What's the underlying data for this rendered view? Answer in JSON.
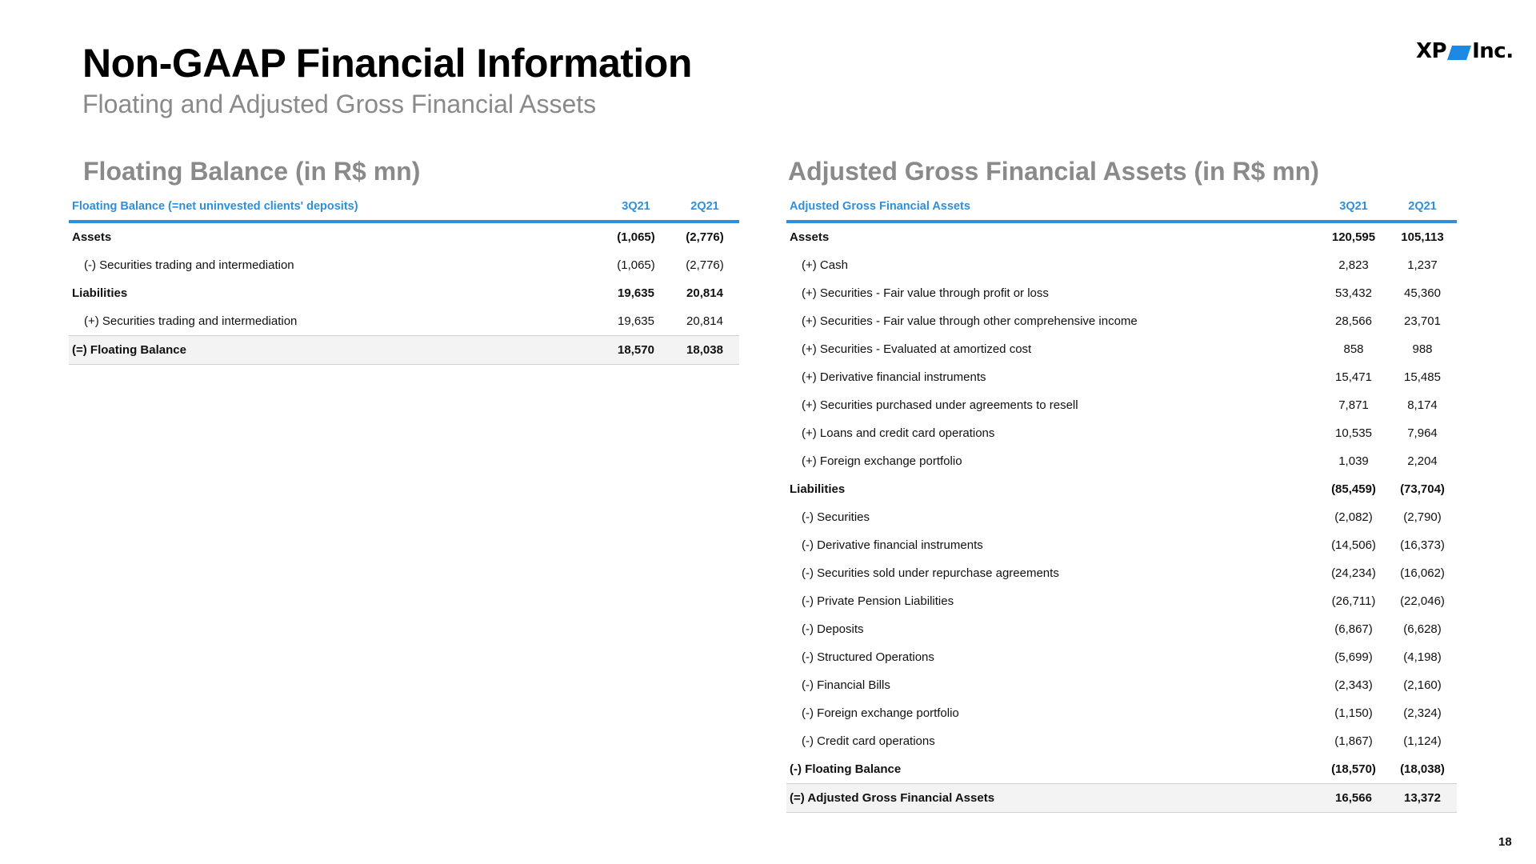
{
  "header": {
    "title": "Non-GAAP Financial Information",
    "subtitle": "Floating and Adjusted Gross Financial Assets",
    "logo_text_left": "XP",
    "logo_text_right": "Inc."
  },
  "colors": {
    "accent_blue": "#2f8fd8",
    "logo_blue": "#1e88e5",
    "section_gray": "#8a8a8a"
  },
  "floating": {
    "section_title": "Floating Balance (in R$ mn)",
    "columns": [
      "Floating Balance (=net uninvested clients' deposits)",
      "3Q21",
      "2Q21"
    ],
    "rows": [
      {
        "label": "Assets",
        "v1": "(1,065)",
        "v2": "(2,776)"
      },
      {
        "label": "(-) Securities trading and intermediation",
        "v1": "(1,065)",
        "v2": "(2,776)"
      },
      {
        "label": "Liabilities",
        "v1": "19,635",
        "v2": "20,814"
      },
      {
        "label": "(+) Securities trading and intermediation",
        "v1": "19,635",
        "v2": "20,814"
      },
      {
        "label": "(=) Floating Balance",
        "v1": "18,570",
        "v2": "18,038"
      }
    ]
  },
  "adjusted": {
    "section_title": "Adjusted Gross Financial Assets (in R$ mn)",
    "columns": [
      "Adjusted Gross Financial Assets",
      "3Q21",
      "2Q21"
    ],
    "rows": [
      {
        "label": "Assets",
        "v1": "120,595",
        "v2": "105,113"
      },
      {
        "label": "(+) Cash",
        "v1": "2,823",
        "v2": "1,237"
      },
      {
        "label": "(+) Securities - Fair value through profit or loss",
        "v1": "53,432",
        "v2": "45,360"
      },
      {
        "label": "(+) Securities - Fair value through other comprehensive income",
        "v1": "28,566",
        "v2": "23,701"
      },
      {
        "label": "(+) Securities - Evaluated at amortized cost",
        "v1": "858",
        "v2": "988"
      },
      {
        "label": "(+) Derivative financial instruments",
        "v1": "15,471",
        "v2": "15,485"
      },
      {
        "label": "(+) Securities purchased under agreements to resell",
        "v1": "7,871",
        "v2": "8,174"
      },
      {
        "label": "(+) Loans and credit card operations",
        "v1": "10,535",
        "v2": "7,964"
      },
      {
        "label": "(+) Foreign exchange portfolio",
        "v1": "1,039",
        "v2": "2,204"
      },
      {
        "label": "Liabilities",
        "v1": "(85,459)",
        "v2": "(73,704)"
      },
      {
        "label": "(-) Securities",
        "v1": "(2,082)",
        "v2": "(2,790)"
      },
      {
        "label": "(-) Derivative financial instruments",
        "v1": "(14,506)",
        "v2": "(16,373)"
      },
      {
        "label": "(-) Securities sold under repurchase agreements",
        "v1": "(24,234)",
        "v2": "(16,062)"
      },
      {
        "label": "(-) Private Pension Liabilities",
        "v1": "(26,711)",
        "v2": "(22,046)"
      },
      {
        "label": "(-) Deposits",
        "v1": "(6,867)",
        "v2": "(6,628)"
      },
      {
        "label": "(-) Structured Operations",
        "v1": "(5,699)",
        "v2": "(4,198)"
      },
      {
        "label": "(-) Financial Bills",
        "v1": "(2,343)",
        "v2": "(2,160)"
      },
      {
        "label": "(-) Foreign exchange portfolio",
        "v1": "(1,150)",
        "v2": "(2,324)"
      },
      {
        "label": "(-) Credit card operations",
        "v1": "(1,867)",
        "v2": "(1,124)"
      },
      {
        "label": "(-) Floating Balance",
        "v1": "(18,570)",
        "v2": "(18,038)"
      },
      {
        "label": "(=) Adjusted Gross Financial Assets",
        "v1": "16,566",
        "v2": "13,372"
      }
    ]
  },
  "footer": {
    "page_number": "18"
  }
}
